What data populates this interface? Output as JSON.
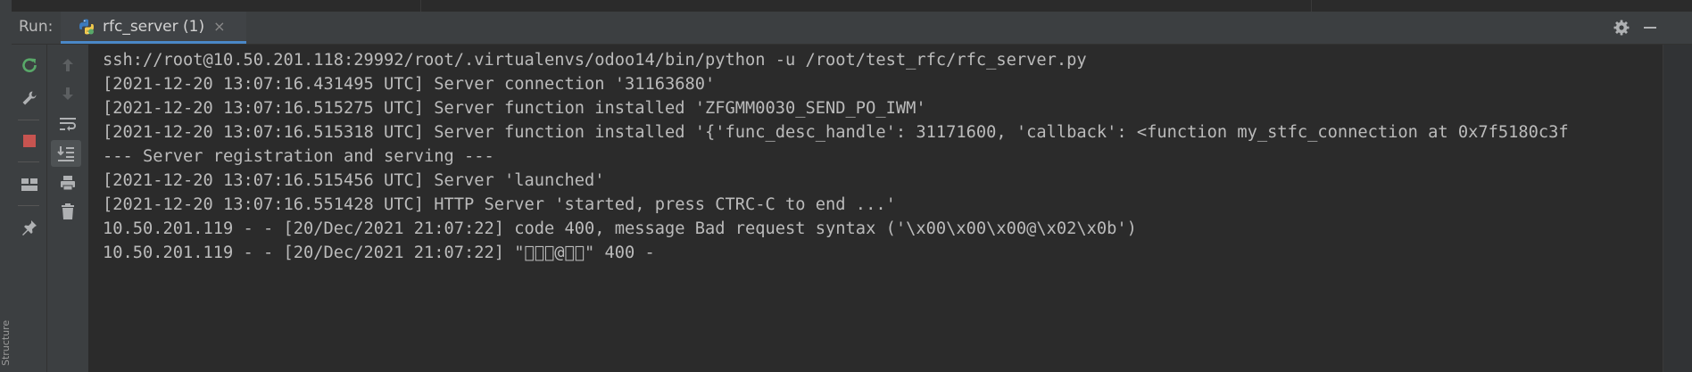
{
  "sidebar_edge": {
    "label": "Structure"
  },
  "run_panel": {
    "label": "Run:",
    "tab": {
      "label": "rfc_server (1)",
      "close": "×",
      "icon": "python-icon"
    }
  },
  "header_icons": [
    "gear-icon",
    "minimize-icon"
  ],
  "toolbar_left": [
    "rerun-icon",
    "wrench-icon",
    "stop-icon",
    "layout-icon",
    "pin-icon"
  ],
  "toolbar_right": [
    "arrow-up-icon",
    "arrow-down-icon",
    "soft-wrap-icon",
    "scroll-to-end-icon",
    "print-icon",
    "trash-icon"
  ],
  "colors": {
    "accent": "#4a88c7",
    "stop": "#c75450",
    "rerun": "#59a869",
    "text": "#bbbbbb"
  },
  "console": {
    "lines": [
      "ssh://root@10.50.201.118:29992/root/.virtualenvs/odoo14/bin/python -u /root/test_rfc/rfc_server.py",
      "[2021-12-20 13:07:16.431495 UTC] Server connection '31163680'",
      "[2021-12-20 13:07:16.515275 UTC] Server function installed 'ZFGMM0030_SEND_PO_IWM'",
      "[2021-12-20 13:07:16.515318 UTC] Server function installed '{'func_desc_handle': 31171600, 'callback': <function my_stfc_connection at 0x7f5180c3f",
      "--- Server registration and serving ---",
      "[2021-12-20 13:07:16.515456 UTC] Server 'launched'",
      "[2021-12-20 13:07:16.551428 UTC] HTTP Server 'started, press CTRC-C to end ...'",
      "10.50.201.119 - - [20/Dec/2021 21:07:22] code 400, message Bad request syntax ('\\x00\\x00\\x00@\\x02\\x0b')",
      "10.50.201.119 - - [20/Dec/2021 21:07:22] \"\u0000\u0000\u0000@\u0002\u000b\" 400 -"
    ]
  }
}
